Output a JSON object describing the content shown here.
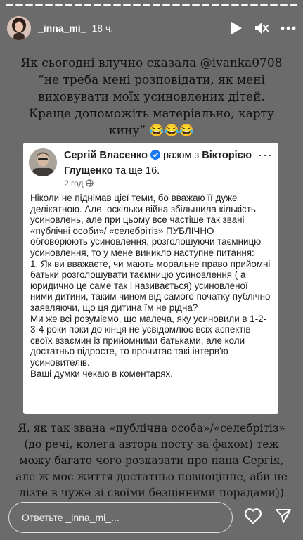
{
  "story": {
    "background": "#6b6b6b",
    "progress_segments": 30
  },
  "header": {
    "username": "_inna_mi_",
    "time": "18 ч.",
    "icons": [
      "play-icon",
      "mute-icon",
      "more-icon"
    ]
  },
  "top_text": {
    "line1_prefix": "Як сьогодні влучно сказала ",
    "mention": "@ivanka0708",
    "line2": "“не треба мені розповідати, як мені виховувати моїх усиновлених дітей. Краще допоможіть матеріально, карту кину” 😂😂😂"
  },
  "post": {
    "author": "Сергій Власенко",
    "with_text": "разом з",
    "tagged": "Вікторією Глущенко",
    "and_text": "та ще 16.",
    "time": "2 год",
    "more": "···",
    "body": "Ніколи не піднімав цієї теми, бо вважаю її дуже делікатною. Але, оскільки війна збільшила кількість усиновлень, але при цьому все частіше так звані «публічні особи»/ «селебрітіз» ПУБЛІЧНО обговорюють усиновлення, розголошуючи таємницю усиновлення, то у мене виникло наступне питання:\n1. Як ви вважаєте, чи мають моральне право прийомні батьки розголошувати таємницю усиновлення ( а юридично це саме так і називається) усиновленої ними дитини, таким чином від самого початку публічно заявляючи, що ця дитина їм не рідна?\nМи же всі розуміємо, що малеча, яку усиновили в 1-2-3-4 роки поки до кінця не усвідомлює всіх аспектів своїх взаємин із прийомними батьками, але коли достатньо підросте, то прочитає такі інтерв'ю усиновителів.\nВаші думки чекаю в коментарях."
  },
  "bottom_text": "Я, як так звана «публічна особа»/«селебрітіз» (до речі, колега автора посту за фахом) теж можу багато чого розказати про пана Сергія, але ж моє життя достатньо повноцінне, аби не лізте в чуже зі своїми безцінними порадами))",
  "reply": {
    "placeholder": "Ответьте _inna_mi_..."
  }
}
